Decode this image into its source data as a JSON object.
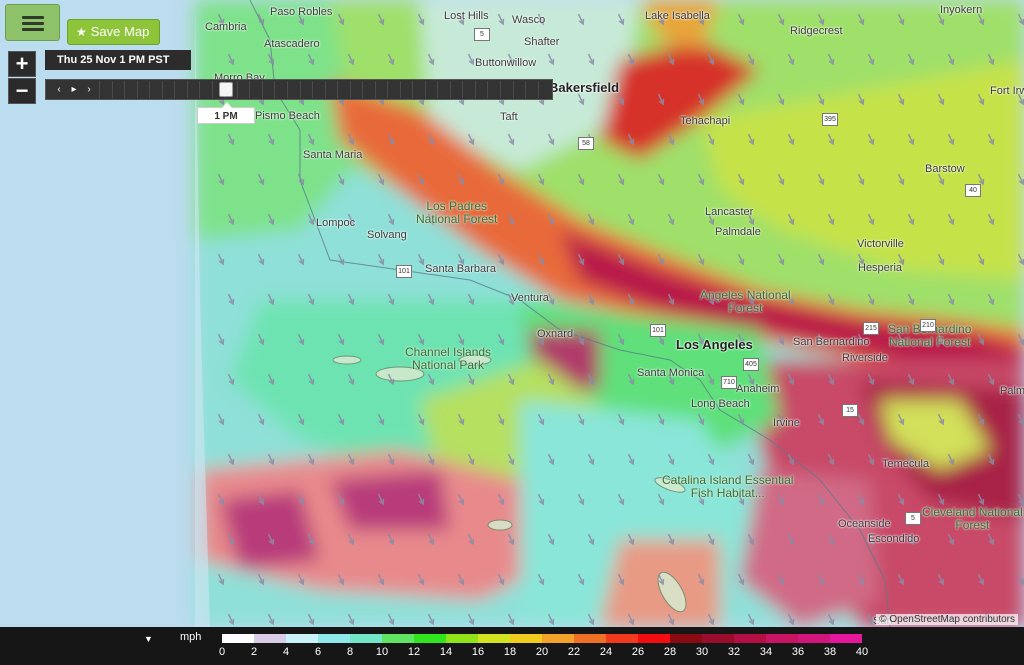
{
  "controls": {
    "save_map_label": "Save Map",
    "zoom_in_label": "+",
    "zoom_out_label": "−",
    "time_label": "Thu 25 Nov 1 PM PST",
    "prev_label": "‹",
    "play_label": "▸",
    "next_label": "›",
    "slider_label": "1 PM"
  },
  "legend": {
    "unit": "mph",
    "ticks": [
      "0",
      "2",
      "4",
      "6",
      "8",
      "10",
      "12",
      "14",
      "16",
      "18",
      "20",
      "22",
      "24",
      "26",
      "28",
      "30",
      "32",
      "34",
      "36",
      "38",
      "40"
    ],
    "colors": [
      "#ffffff",
      "#d8cce6",
      "#c9f3f8",
      "#8fe8ea",
      "#72e6c6",
      "#61e363",
      "#30e41e",
      "#8fe318",
      "#d3e320",
      "#f1cc20",
      "#f3a32a",
      "#f07026",
      "#f33a1e",
      "#f40d10",
      "#8a0a12",
      "#9a0c2c",
      "#b40f45",
      "#c81462",
      "#d2157d",
      "#e5179c"
    ]
  },
  "map": {
    "places": [
      {
        "name": "Paso Robles",
        "cls": "place"
      },
      {
        "name": "Lost Hills",
        "cls": "place"
      },
      {
        "name": "Wasco",
        "cls": "place"
      },
      {
        "name": "Lake Isabella",
        "cls": "place"
      },
      {
        "name": "Inyokern",
        "cls": "place"
      },
      {
        "name": "Cambria",
        "cls": "place"
      },
      {
        "name": "Atascadero",
        "cls": "place"
      },
      {
        "name": "Shafter",
        "cls": "place"
      },
      {
        "name": "Ridgecrest",
        "cls": "place"
      },
      {
        "name": "Buttonwillow",
        "cls": "place"
      },
      {
        "name": "Bakersfield",
        "cls": "place big"
      },
      {
        "name": "Morro Bay",
        "cls": "place"
      },
      {
        "name": "Pismo Beach",
        "cls": "place"
      },
      {
        "name": "Taft",
        "cls": "place"
      },
      {
        "name": "Tehachapi",
        "cls": "place"
      },
      {
        "name": "Fort Irwin",
        "cls": "place"
      },
      {
        "name": "Santa Maria",
        "cls": "place"
      },
      {
        "name": "Barstow",
        "cls": "place"
      },
      {
        "name": "Los Padres National Forest",
        "cls": "place park"
      },
      {
        "name": "Lancaster",
        "cls": "place"
      },
      {
        "name": "Lompoc",
        "cls": "place"
      },
      {
        "name": "Solvang",
        "cls": "place"
      },
      {
        "name": "Palmdale",
        "cls": "place"
      },
      {
        "name": "Victorville",
        "cls": "place"
      },
      {
        "name": "Santa Barbara",
        "cls": "place"
      },
      {
        "name": "Hesperia",
        "cls": "place"
      },
      {
        "name": "Angeles National Forest",
        "cls": "place park"
      },
      {
        "name": "Ventura",
        "cls": "place"
      },
      {
        "name": "San Bernardino National Forest",
        "cls": "place park"
      },
      {
        "name": "Oxnard",
        "cls": "place"
      },
      {
        "name": "Los Angeles",
        "cls": "place big"
      },
      {
        "name": "San Bernardino",
        "cls": "place"
      },
      {
        "name": "Channel Islands National Park",
        "cls": "place park"
      },
      {
        "name": "Riverside",
        "cls": "place"
      },
      {
        "name": "Santa Monica",
        "cls": "place"
      },
      {
        "name": "Anaheim",
        "cls": "place"
      },
      {
        "name": "Palm Spr",
        "cls": "place"
      },
      {
        "name": "Long Beach",
        "cls": "place"
      },
      {
        "name": "Irvine",
        "cls": "place"
      },
      {
        "name": "Temecula",
        "cls": "place"
      },
      {
        "name": "Catalina Island Essential Fish Habitat...",
        "cls": "place park"
      },
      {
        "name": "Oceanside",
        "cls": "place"
      },
      {
        "name": "Cleveland National Forest",
        "cls": "place park"
      },
      {
        "name": "Escondido",
        "cls": "place"
      },
      {
        "name": "San",
        "cls": "place"
      }
    ],
    "highways": [
      "5",
      "58",
      "395",
      "40",
      "101",
      "101",
      "215",
      "210",
      "710",
      "405",
      "15",
      "5"
    ],
    "attribution": "© OpenStreetMap contributors"
  }
}
